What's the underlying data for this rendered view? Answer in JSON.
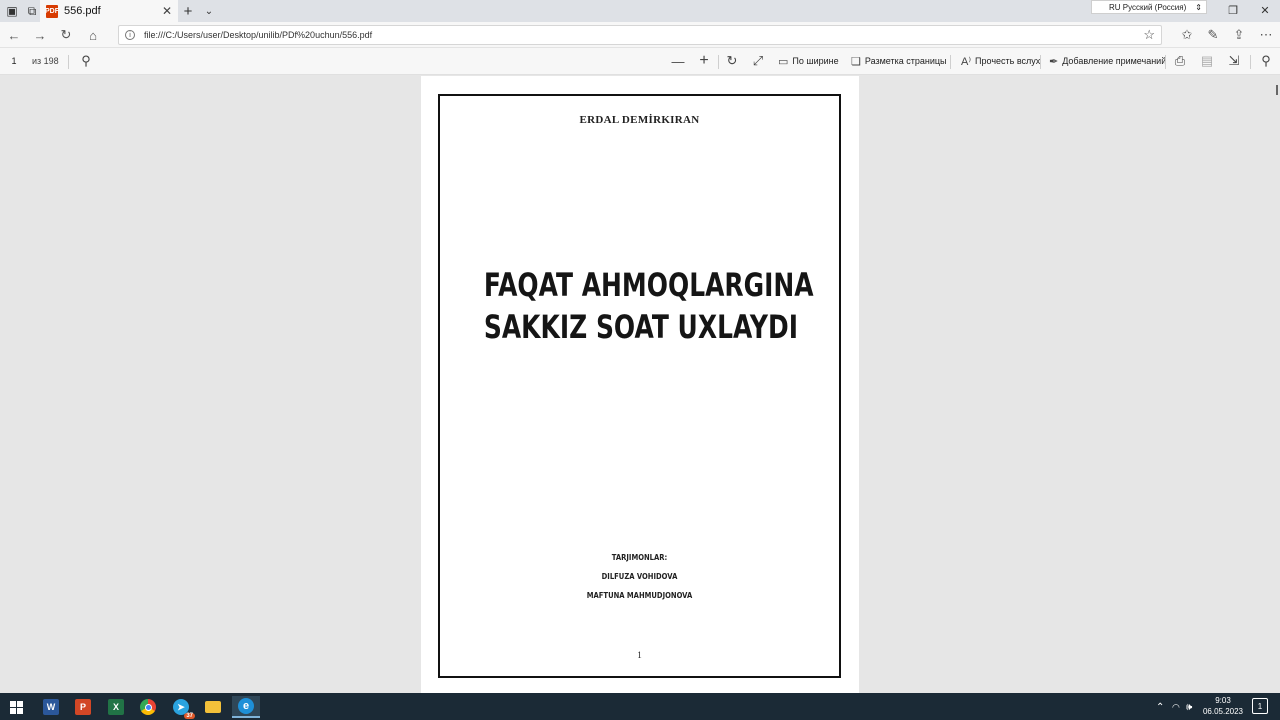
{
  "tab": {
    "title": "556.pdf",
    "pdf_badge": "PDF"
  },
  "language_indicator": {
    "text": "RU Русский (Россия)"
  },
  "address": {
    "url": "file:///C:/Users/user/Desktop/unilib/PDf%20uchun/556.pdf"
  },
  "pdf_toolbar": {
    "page_number": "1",
    "page_of": "из 198",
    "fit_width": "По ширине",
    "page_layout": "Разметка страницы",
    "read_aloud": "Прочесть вслух",
    "add_notes": "Добавление примечаний"
  },
  "document": {
    "author": "ERDAL DEMİRKIRAN",
    "title_line1": "FAQAT AHMOQLARGINA",
    "title_line2": "SAKKIZ SOAT UXLAYDI",
    "translators_label": "TARJIMONLAR:",
    "translator1": "DILFUZA VOHIDOVA",
    "translator2": "MAFTUNA MAHMUDJONOVA",
    "page_footer": "1"
  },
  "taskbar": {
    "apps": [
      "start",
      "word",
      "powerpoint",
      "excel",
      "chrome",
      "telegram",
      "file-explorer",
      "edge"
    ],
    "telegram_badge": "37",
    "time": "9:03",
    "date": "06.05.2023",
    "notification_count": "1"
  },
  "colors": {
    "tabbar": "#dee1e6",
    "viewer_bg": "#e6e6e6",
    "taskbar": "#1b2a36",
    "pdf_red": "#d83b01"
  }
}
